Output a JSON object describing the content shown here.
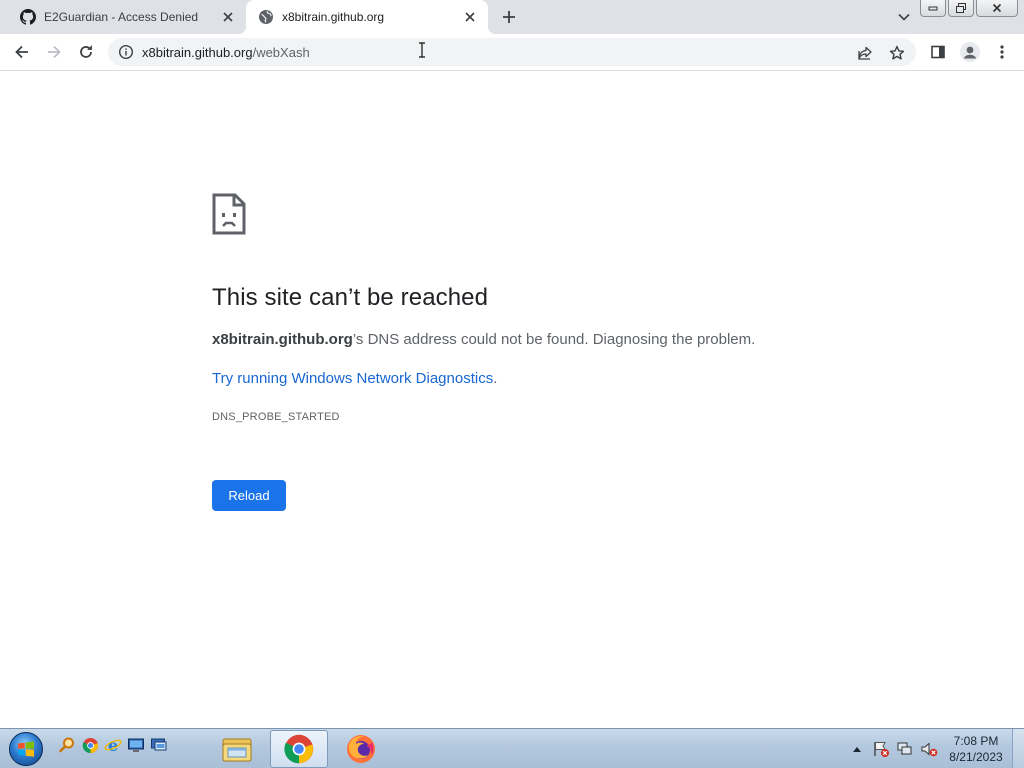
{
  "browser": {
    "tabs": [
      {
        "title": "E2Guardian - Access Denied",
        "favicon": "github-icon",
        "active": false
      },
      {
        "title": "x8bitrain.github.org",
        "favicon": "globe-icon",
        "active": true
      }
    ],
    "address_bar": {
      "host": "x8bitrain.github.org",
      "path": "/webXash"
    }
  },
  "error_page": {
    "icon": "sad-page-icon",
    "heading": "This site can’t be reached",
    "description_host": "x8bitrain.github.org",
    "description_rest": "’s DNS address could not be found. Diagnosing the problem.",
    "suggestion_link": "Try running Windows Network Diagnostics",
    "suggestion_suffix": ".",
    "error_code": "DNS_PROBE_STARTED",
    "reload_label": "Reload"
  },
  "taskbar": {
    "quick_launch": [
      "search-icon",
      "chrome-icon",
      "ie-icon",
      "desktop-icon",
      "remote-desktop-icon"
    ],
    "pinned": [
      "file-explorer-icon",
      "chrome-icon",
      "firefox-icon"
    ],
    "clock": {
      "time": "7:08 PM",
      "date": "8/21/2023"
    }
  },
  "colors": {
    "accent": "#1a73e8",
    "tab_strip": "#dee1e6",
    "omnibox": "#f1f3f4",
    "heading_text": "#202124",
    "body_text": "#5f6368"
  }
}
